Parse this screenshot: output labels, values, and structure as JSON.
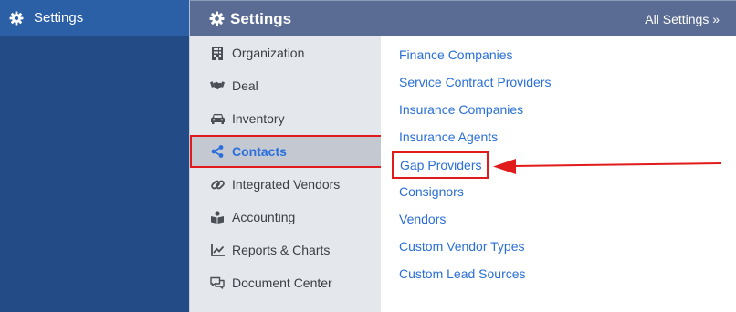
{
  "left_nav": {
    "settings_label": "Settings"
  },
  "header": {
    "title": "Settings",
    "all_settings_link": "All Settings »"
  },
  "categories": [
    {
      "label": "Organization",
      "icon": "building-icon"
    },
    {
      "label": "Deal",
      "icon": "handshake-icon"
    },
    {
      "label": "Inventory",
      "icon": "car-icon"
    },
    {
      "label": "Contacts",
      "icon": "share-icon",
      "active": true
    },
    {
      "label": "Integrated Vendors",
      "icon": "link-icon"
    },
    {
      "label": "Accounting",
      "icon": "book-reader-icon"
    },
    {
      "label": "Reports & Charts",
      "icon": "line-chart-icon"
    },
    {
      "label": "Document Center",
      "icon": "comments-icon"
    }
  ],
  "links": [
    {
      "label": "Finance Companies"
    },
    {
      "label": "Service Contract Providers"
    },
    {
      "label": "Insurance Companies"
    },
    {
      "label": "Insurance Agents"
    },
    {
      "label": "Gap Providers",
      "highlighted": true
    },
    {
      "label": "Consignors"
    },
    {
      "label": "Vendors"
    },
    {
      "label": "Custom Vendor Types"
    },
    {
      "label": "Custom Lead Sources"
    }
  ],
  "colors": {
    "sidebar": "#234b86",
    "header": "#5a6c93",
    "link": "#2a6fd6",
    "active_text": "#2a6fdb",
    "annotation_red": "#e11b1b"
  }
}
